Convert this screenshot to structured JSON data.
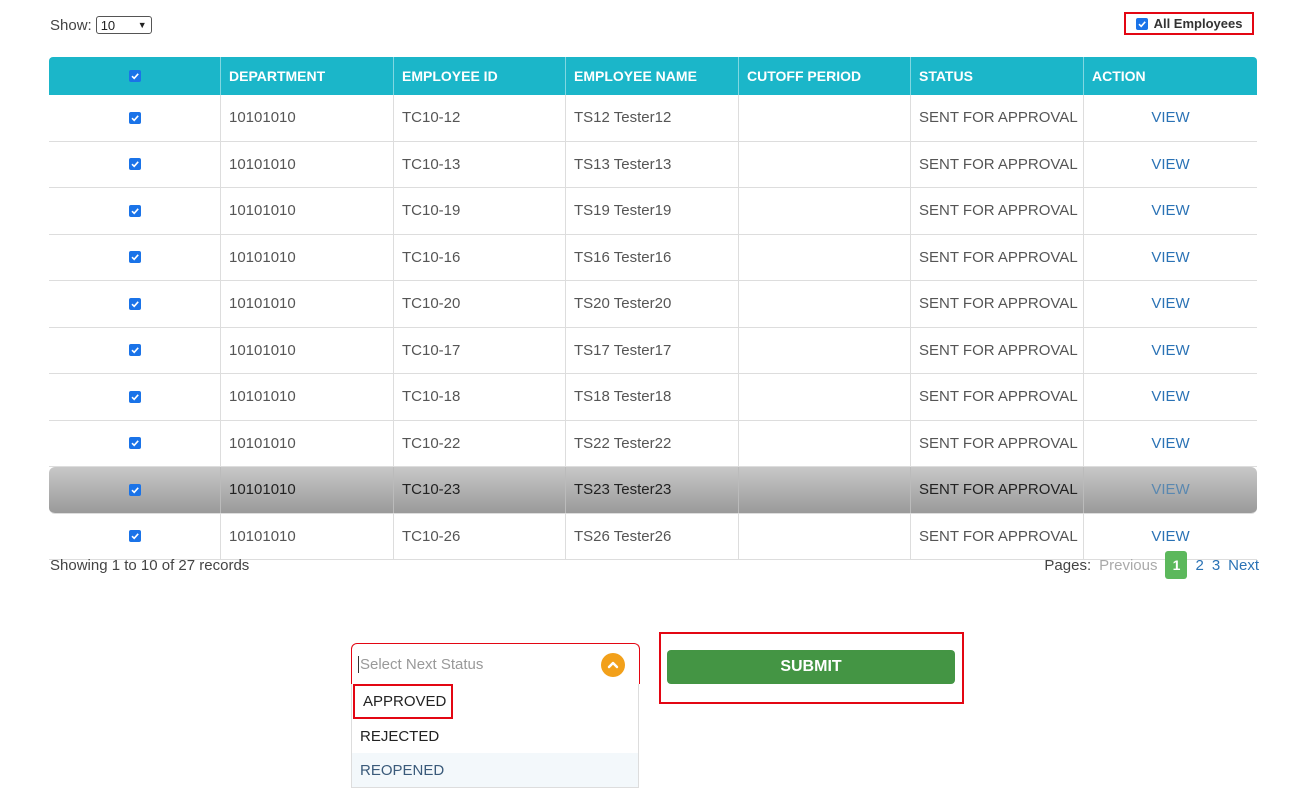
{
  "show": {
    "label": "Show:",
    "value": "10"
  },
  "all_employees": {
    "label": "All Employees",
    "checked": true
  },
  "table": {
    "headers": [
      "DEPARTMENT",
      "EMPLOYEE ID",
      "EMPLOYEE NAME",
      "CUTOFF PERIOD",
      "STATUS",
      "ACTION"
    ],
    "rows": [
      {
        "department": "10101010",
        "employee_id": "TC10-12",
        "name": "TS12 Tester12",
        "cutoff": "",
        "status": "SENT FOR APPROVAL",
        "action": "VIEW"
      },
      {
        "department": "10101010",
        "employee_id": "TC10-13",
        "name": "TS13 Tester13",
        "cutoff": "",
        "status": "SENT FOR APPROVAL",
        "action": "VIEW"
      },
      {
        "department": "10101010",
        "employee_id": "TC10-19",
        "name": "TS19 Tester19",
        "cutoff": "",
        "status": "SENT FOR APPROVAL",
        "action": "VIEW"
      },
      {
        "department": "10101010",
        "employee_id": "TC10-16",
        "name": "TS16 Tester16",
        "cutoff": "",
        "status": "SENT FOR APPROVAL",
        "action": "VIEW"
      },
      {
        "department": "10101010",
        "employee_id": "TC10-20",
        "name": "TS20 Tester20",
        "cutoff": "",
        "status": "SENT FOR APPROVAL",
        "action": "VIEW"
      },
      {
        "department": "10101010",
        "employee_id": "TC10-17",
        "name": "TS17 Tester17",
        "cutoff": "",
        "status": "SENT FOR APPROVAL",
        "action": "VIEW"
      },
      {
        "department": "10101010",
        "employee_id": "TC10-18",
        "name": "TS18 Tester18",
        "cutoff": "",
        "status": "SENT FOR APPROVAL",
        "action": "VIEW"
      },
      {
        "department": "10101010",
        "employee_id": "TC10-22",
        "name": "TS22 Tester22",
        "cutoff": "",
        "status": "SENT FOR APPROVAL",
        "action": "VIEW"
      },
      {
        "department": "10101010",
        "employee_id": "TC10-23",
        "name": "TS23 Tester23",
        "cutoff": "",
        "status": "SENT FOR APPROVAL",
        "action": "VIEW"
      },
      {
        "department": "10101010",
        "employee_id": "TC10-26",
        "name": "TS26 Tester26",
        "cutoff": "",
        "status": "SENT FOR APPROVAL",
        "action": "VIEW"
      }
    ]
  },
  "footer": {
    "records_text": "Showing 1 to 10 of 27 records",
    "pages_label": "Pages:",
    "previous": "Previous",
    "pages": [
      "1",
      "2",
      "3"
    ],
    "next": "Next"
  },
  "status_select": {
    "placeholder": "Select Next Status",
    "options": [
      "APPROVED",
      "REJECTED",
      "REOPENED"
    ]
  },
  "submit_label": "SUBMIT",
  "colors": {
    "header": "#1bb6c9",
    "submit": "#449544",
    "highlight": "#e30613",
    "link": "#2a72b5"
  }
}
